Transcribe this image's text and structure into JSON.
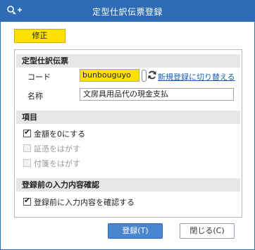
{
  "window": {
    "title": "定型仕訳伝票登録"
  },
  "mode_badge": "修正",
  "voucher_section": {
    "heading": "定型仕訳伝票",
    "code_label": "コード",
    "code_value": "bunbouguyo",
    "switch_link": "新規登録に切り替える",
    "name_label": "名称",
    "name_value": "文房具用品代の現金支払"
  },
  "items_section": {
    "heading": "項目",
    "options": [
      {
        "label": "金額を0にする",
        "checked": true,
        "enabled": true
      },
      {
        "label": "証憑をはがす",
        "checked": false,
        "enabled": false
      },
      {
        "label": "付箋をはがす",
        "checked": false,
        "enabled": false
      }
    ]
  },
  "confirm_section": {
    "heading": "登録前の入力内容確認",
    "option": {
      "label": "登録前に入力内容を確認する",
      "checked": true
    }
  },
  "buttons": {
    "register": "登録(T)",
    "close": "閉じる(C)"
  },
  "colors": {
    "titlebar": "#2f6cb5",
    "highlight": "#ffe100",
    "link": "#1a5fb4",
    "primary_button": "#4a86d0"
  },
  "icons": {
    "title": "key-plus-icon",
    "refresh": "refresh-icon"
  }
}
